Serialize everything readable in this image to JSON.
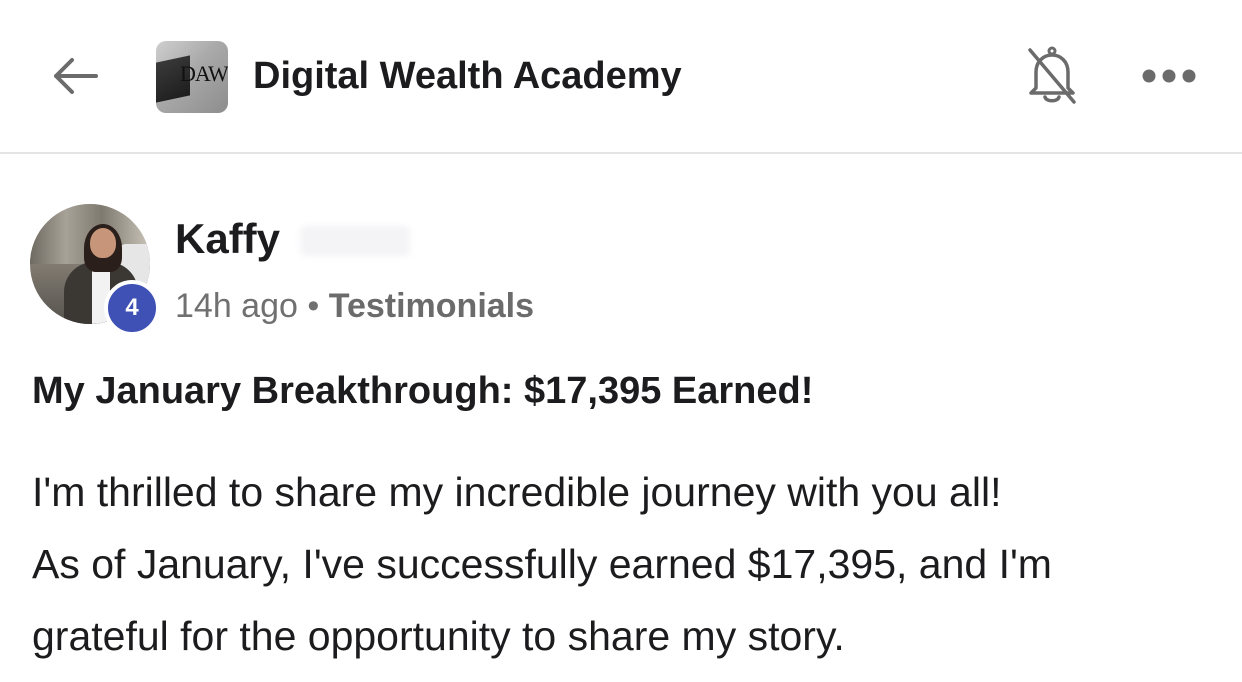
{
  "header": {
    "back_icon": "arrow-left-icon",
    "group_logo_text": "DAW",
    "title": "Digital Wealth Academy",
    "notifications_icon": "bell-off-icon",
    "more_icon": "more-horizontal-icon"
  },
  "post": {
    "author": {
      "name": "Kaffy",
      "level": "4"
    },
    "time_ago": "14h ago",
    "separator": "•",
    "category": "Testimonials",
    "title": "My January Breakthrough: $17,395 Earned!",
    "body_lines": [
      "I'm thrilled to share my incredible journey with you all!",
      "As of January, I've successfully earned $17,395, and I'm",
      "grateful for the opportunity to share my story."
    ]
  },
  "colors": {
    "accent": "#3f51b5",
    "text_primary": "#1c1c1e",
    "text_secondary": "#707070",
    "divider": "#e4e4e7"
  }
}
